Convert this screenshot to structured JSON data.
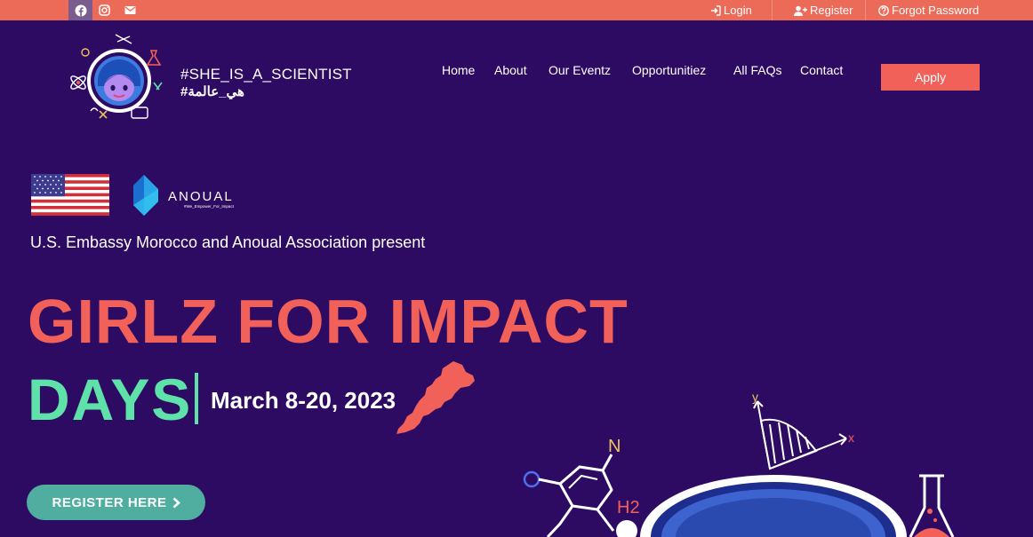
{
  "topbar": {
    "social": [
      {
        "icon": "facebook-icon"
      },
      {
        "icon": "instagram-icon"
      },
      {
        "icon": "envelope-icon"
      }
    ],
    "login": "Login",
    "register": "Register",
    "forgot": "Forgot Password"
  },
  "header": {
    "brand_en": "#SHE_IS_A_SCIENTIST",
    "brand_ar": "#هي_عالمة",
    "nav": [
      "Home",
      "About",
      "Our Eventz",
      "Opportunitiez",
      "All FAQs",
      "Contact"
    ],
    "apply": "Apply"
  },
  "hero": {
    "partner_logo_text": "ANOUAL",
    "partner_tagline": "#We_Empower_For_Impact",
    "present": "U.S. Embassy Morocco and Anoual Association present",
    "title_line1": "GIRLZ FOR IMPACT",
    "title_line2": "DAYS",
    "dates": "March 8-20, 2023",
    "cta": "REGISTER HERE",
    "art_labels": {
      "n": "N",
      "h2": "H2",
      "y": "y",
      "x": "x"
    }
  },
  "colors": {
    "background": "#2e0b62",
    "topbar": "#ec6a58",
    "accent_coral": "#f2605a",
    "accent_green": "#5ee2a9",
    "cta": "#4faea0"
  }
}
